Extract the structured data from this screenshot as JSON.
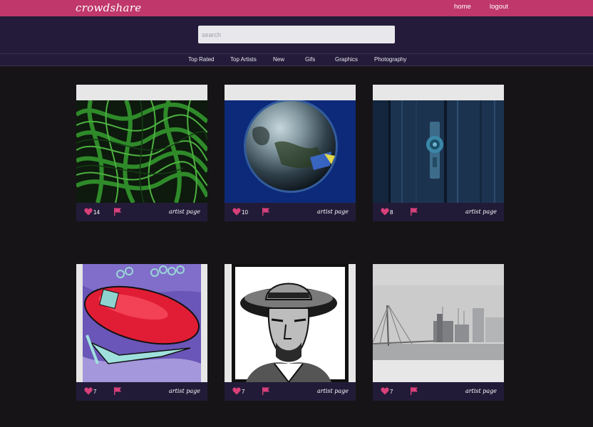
{
  "app": {
    "logo": "crowdshare",
    "top_links": [
      "home",
      "logout"
    ]
  },
  "search": {
    "placeholder": "search"
  },
  "nav": [
    "Top Rated",
    "Top Artists",
    "New",
    "Gifs",
    "Graphics",
    "Photography"
  ],
  "cards": [
    {
      "image": "green-swirl-art",
      "likes": "14",
      "artist_link": "artist page"
    },
    {
      "image": "earth-globe",
      "likes": "10",
      "artist_link": "artist page"
    },
    {
      "image": "blue-wooden-door",
      "likes": "8",
      "artist_link": "artist page"
    },
    {
      "image": "red-knife-illustration",
      "likes": "7",
      "artist_link": "artist page"
    },
    {
      "image": "cowboy-portrait",
      "likes": "7",
      "artist_link": "artist page"
    },
    {
      "image": "foggy-bridge-city",
      "likes": "7",
      "artist_link": "artist page"
    }
  ],
  "colors": {
    "topbar": "#c0386b",
    "header": "#231b39",
    "page_bg": "#171417",
    "card_bg": "#e7e7e7",
    "accent": "#d8407a"
  },
  "icons": {
    "like": "heart-icon",
    "report": "flag-icon"
  }
}
